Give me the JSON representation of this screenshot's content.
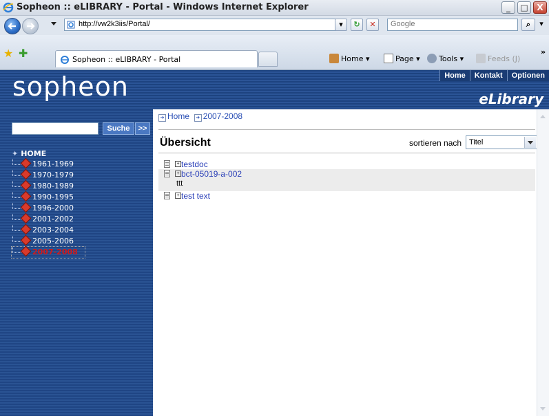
{
  "window": {
    "title": "Sopheon :: eLIBRARY - Portal - Windows Internet Explorer",
    "minimize": "_",
    "maximize": "□",
    "close": "X"
  },
  "addressbar": {
    "url": "http://vw2k3iis/Portal/",
    "search_placeholder": "Google"
  },
  "tabs": [
    {
      "label": "Sopheon :: eLIBRARY - Portal"
    }
  ],
  "commandbar": {
    "home": "Home",
    "page": "Page",
    "tools": "Tools",
    "feeds": "Feeds (J)",
    "more": "»"
  },
  "site": {
    "logo": "sopheon",
    "subtitle": "eLibrary",
    "topnav": [
      "Home",
      "Kontakt",
      "Optionen"
    ]
  },
  "search": {
    "button": "Suche",
    "go": ">>",
    "value": ""
  },
  "tree": {
    "root": "HOME",
    "items": [
      "1961-1969",
      "1970-1979",
      "1980-1989",
      "1990-1995",
      "1996-2000",
      "2001-2002",
      "2003-2004",
      "2005-2006",
      "2007-2008"
    ],
    "active": "2007-2008"
  },
  "breadcrumb": [
    "Home",
    "2007-2008"
  ],
  "content": {
    "heading": "Übersicht",
    "sort_label": "sortieren nach",
    "sort_value": "Titel",
    "documents": [
      {
        "title": "testdoc",
        "description": ""
      },
      {
        "title": "bct-05019-a-002",
        "description": "ttt"
      },
      {
        "title": "test text",
        "description": ""
      }
    ]
  }
}
